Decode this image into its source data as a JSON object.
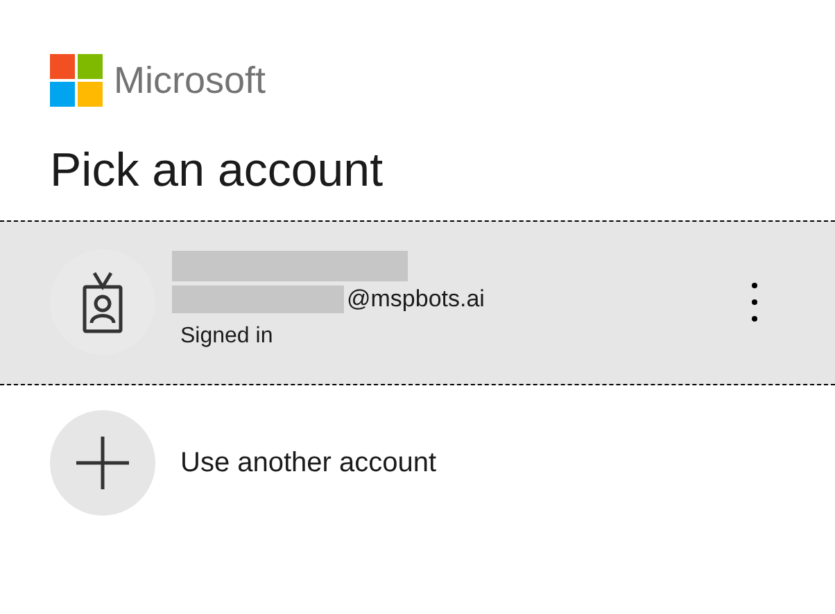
{
  "brand": {
    "name": "Microsoft"
  },
  "title": "Pick an account",
  "accounts": [
    {
      "kind": "account",
      "email": "@mspbots.ai",
      "status": "Signed in",
      "selected": true
    },
    {
      "kind": "add",
      "label": "Use another account",
      "selected": false
    }
  ]
}
